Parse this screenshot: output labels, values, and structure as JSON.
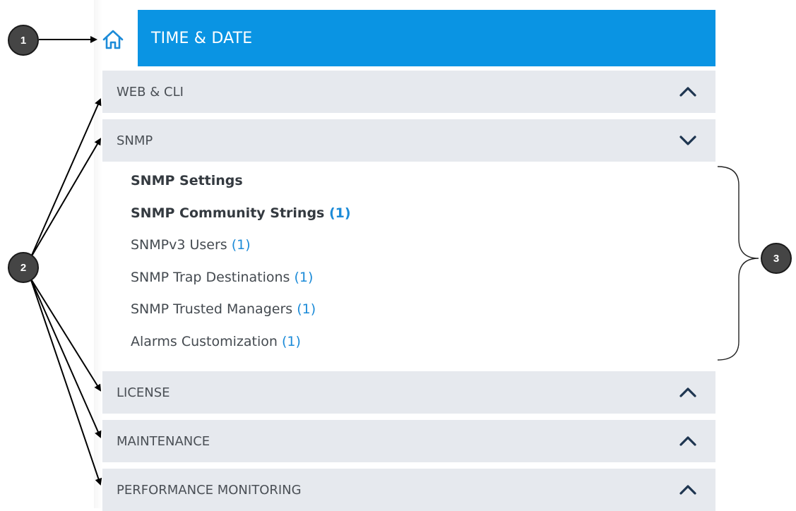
{
  "header": {
    "title": "TIME & DATE",
    "home_icon": "home-icon",
    "accent_color": "#0a94e3"
  },
  "sections": [
    {
      "label": "WEB & CLI",
      "state": "collapsed",
      "chevron": "chevron-up-icon"
    },
    {
      "label": "SNMP",
      "state": "expanded",
      "chevron": "chevron-down-icon"
    },
    {
      "label": "LICENSE",
      "state": "collapsed",
      "chevron": "chevron-up-icon"
    },
    {
      "label": "MAINTENANCE",
      "state": "collapsed",
      "chevron": "chevron-up-icon"
    },
    {
      "label": "PERFORMANCE MONITORING",
      "state": "collapsed",
      "chevron": "chevron-up-icon"
    }
  ],
  "snmp_items": [
    {
      "label": "SNMP Settings",
      "count": ""
    },
    {
      "label": "SNMP Community Strings",
      "count": "(1)"
    },
    {
      "label": "SNMPv3 Users",
      "count": "(1)"
    },
    {
      "label": "SNMP Trap Destinations",
      "count": "(1)"
    },
    {
      "label": "SNMP Trusted Managers",
      "count": "(1)"
    },
    {
      "label": "Alarms Customization",
      "count": "(1)"
    }
  ],
  "callouts": [
    "1",
    "2",
    "3"
  ]
}
